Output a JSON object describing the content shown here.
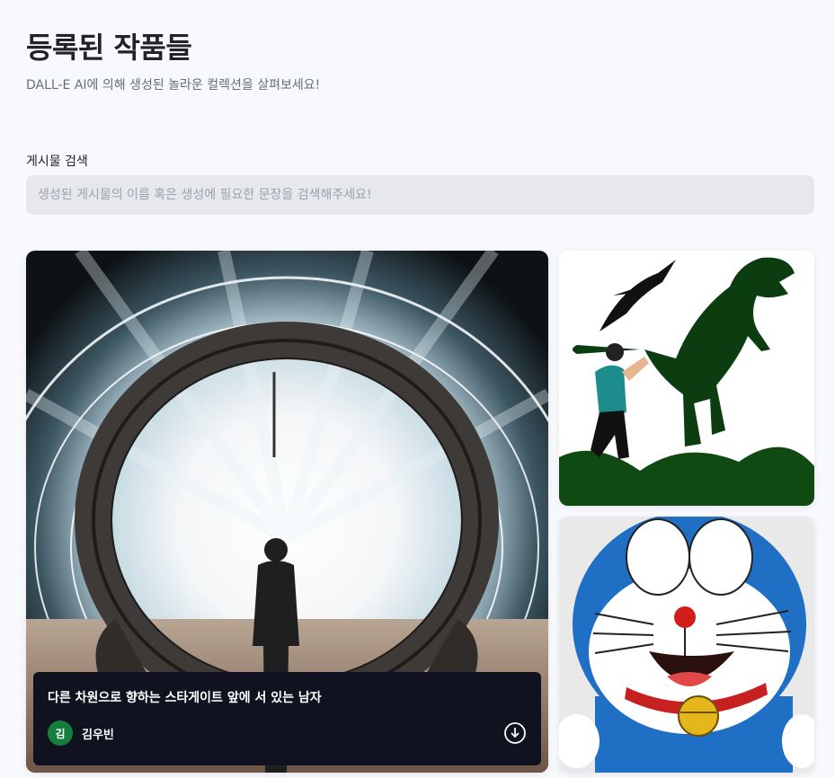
{
  "header": {
    "title": "등록된 작품들",
    "subtitle": "DALL-E AI에 의해 생성된 놀라운 컬렉션을 살펴보세요!"
  },
  "search": {
    "label": "게시물 검색",
    "placeholder": "생성된 게시물의 이름 혹은 생성에 필요한 문장을 검색해주세요!",
    "value": ""
  },
  "posts": [
    {
      "prompt": "다른 차원으로 향하는 스타게이트 앞에 서 있는 남자",
      "author": "김우빈",
      "avatar_initial": "김",
      "avatar_color": "#15803d",
      "image_icon": "stargate-image"
    },
    {
      "image_icon": "dinosaur-chase-image"
    },
    {
      "image_icon": "doraemon-image"
    }
  ],
  "icons": {
    "download": "download-icon"
  }
}
